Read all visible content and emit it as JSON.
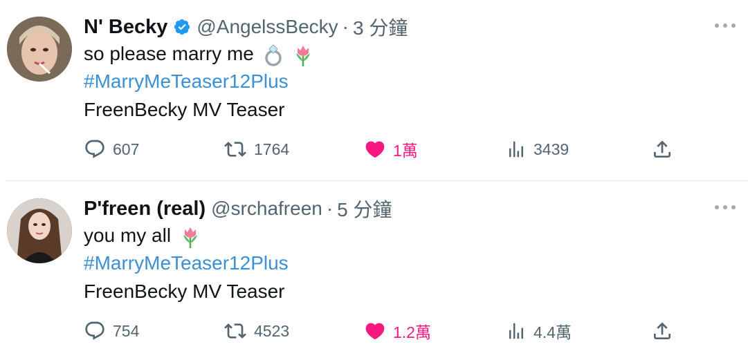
{
  "tweets": [
    {
      "name": "N' Becky",
      "verified": true,
      "handle": "@AngelssBecky",
      "separator": "·",
      "time": "3 分鐘",
      "text": "so please marry me",
      "emojis": [
        "ring-icon",
        "tulip-icon"
      ],
      "hashtag": "#MarryMeTeaser12Plus",
      "body": "FreenBecky MV Teaser",
      "replies": "607",
      "retweets": "1764",
      "likes": "1萬",
      "views": "3439"
    },
    {
      "name": "P'freen (real)",
      "verified": false,
      "handle": "@srchafreen",
      "separator": "·",
      "time": "5 分鐘",
      "text": "you my all",
      "emojis": [
        "tulip-icon"
      ],
      "hashtag": "#MarryMeTeaser12Plus",
      "body": "FreenBecky MV Teaser",
      "replies": "754",
      "retweets": "4523",
      "likes": "1.2萬",
      "views": "4.4萬"
    }
  ],
  "colors": {
    "name": "#0f1419",
    "secondary": "#536471",
    "hashtag": "#3a8fd6",
    "like": "#f91880",
    "verified": "#1d9bf0",
    "divider": "#e1e6ea"
  }
}
